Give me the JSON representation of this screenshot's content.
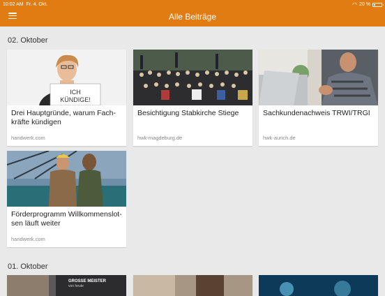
{
  "status_bar": {
    "time": "10:02 AM",
    "date": "Fr. 4. Okt.",
    "battery_percent": "20 %",
    "battery_level": 0.2
  },
  "appbar": {
    "title": "Alle Beiträge",
    "menu_icon": "hamburger-menu-icon"
  },
  "sections": [
    {
      "label": "02. Oktober",
      "articles": [
        {
          "headline": "Drei Hauptgründe, warum Fach-kräfte kündigen",
          "source": "handwerk.com",
          "image_text": "ICH KÜNDIGE!"
        },
        {
          "headline": "Besichtigung Stabkirche Stiege",
          "source": "hwk-magdeburg.de"
        },
        {
          "headline": "Sachkundenachweis TRWI/TRGI",
          "source": "hwk-aurich.de"
        },
        {
          "headline": "Förderprogramm Willkommenslot-sen läuft weiter",
          "source": "handwerk.com"
        }
      ]
    },
    {
      "label": "01. Oktober",
      "articles": [
        {
          "image_text": "GROSSE MEISTER von heute"
        },
        {},
        {}
      ]
    }
  ],
  "colors": {
    "accent": "#e07c12",
    "background": "#e9e9e9"
  }
}
